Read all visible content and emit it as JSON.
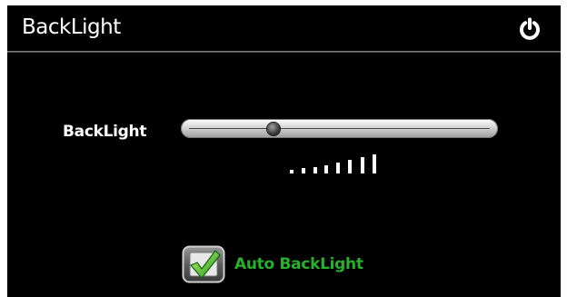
{
  "header": {
    "title": "BackLight",
    "power_icon": "power-icon"
  },
  "backlight": {
    "label": "BackLight",
    "level": 0.28
  },
  "level_indicator": {
    "bar_count": 8
  },
  "auto_backlight": {
    "label": "Auto BackLight",
    "checked": true,
    "label_color": "#27b12d"
  }
}
